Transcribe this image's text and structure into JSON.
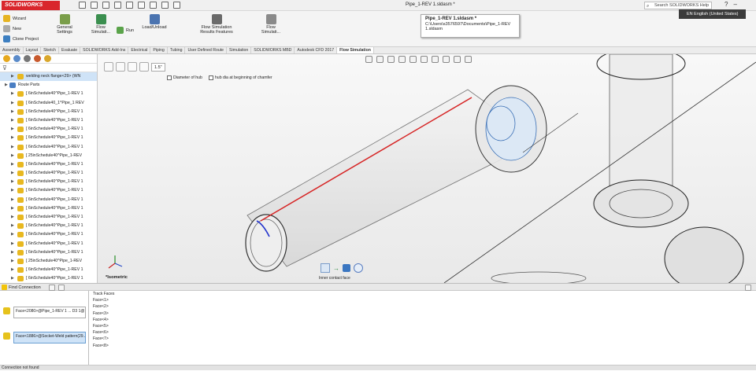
{
  "app": {
    "logo": "SOLIDWORKS",
    "doc_title": "Pipe_1-REV 1.sldasm *",
    "search_help": "Search SOLIDWORKS Help"
  },
  "ribbon": {
    "wizard": "Wizard",
    "new": "New",
    "clone_project": "Clone Project",
    "general_settings": "General Settings",
    "flow_simulation": "Flow Simulati...",
    "run": "Run",
    "load_unload": "Load/Unload",
    "flow_results": "Flow Simulation Results Features",
    "flow_sim_2": "Flow Simulati..."
  },
  "tooltip": {
    "title": "Pipe_1-REV 1.sldasm *",
    "path_line1": "C:\\Users\\s3576597\\Documents\\Pipe_1-REV",
    "path_line2": "1.sldasm"
  },
  "language": "EN English (United States)",
  "tabs": [
    "Assembly",
    "Layout",
    "Sketch",
    "Evaluate",
    "SOLIDWORKS Add-Ins",
    "Electrical",
    "Piping",
    "Tubing",
    "User Defined Route",
    "Simulation",
    "SOLIDWORKS MBD",
    "Autodesk CFD 2017",
    "Flow Simulation"
  ],
  "active_tab": "Flow Simulation",
  "tree": [
    {
      "label": "welding neck flange<29> (WN",
      "indent": 1,
      "sel": true
    },
    {
      "label": "Route Parts",
      "indent": 0,
      "sel": false
    },
    {
      "label": "[ 6inSchedule40^Pipe_1-REV 1",
      "indent": 1
    },
    {
      "label": "[ 6inSchedule40_1^Pipe_1 REV",
      "indent": 1
    },
    {
      "label": "[ 6inSchedule40^Pipe_1-REV 1",
      "indent": 1
    },
    {
      "label": "[ 6inSchedule40^Pipe_1-REV 1",
      "indent": 1
    },
    {
      "label": "[ 6inSchedule40^Pipe_1-REV 1",
      "indent": 1
    },
    {
      "label": "[ 6inSchedule40^Pipe_1-REV 1",
      "indent": 1
    },
    {
      "label": "[ 6inSchedule40^Pipe_1-REV 1",
      "indent": 1
    },
    {
      "label": "[ 25inSchedule40^Pipe_1-REV",
      "indent": 1
    },
    {
      "label": "[ 6inSchedule40^Pipe_1-REV 1",
      "indent": 1
    },
    {
      "label": "[ 6inSchedule40^Pipe_1-REV 1",
      "indent": 1
    },
    {
      "label": "[ 6inSchedule40^Pipe_1-REV 1",
      "indent": 1
    },
    {
      "label": "[ 6inSchedule40^Pipe_1-REV 1",
      "indent": 1
    },
    {
      "label": "[ 6inSchedule40^Pipe_1-REV 1",
      "indent": 1
    },
    {
      "label": "[ 6inSchedule40^Pipe_1-REV 1",
      "indent": 1
    },
    {
      "label": "[ 6inSchedule40^Pipe_1-REV 1",
      "indent": 1
    },
    {
      "label": "[ 6inSchedule40^Pipe_1-REV 1",
      "indent": 1
    },
    {
      "label": "[ 6inSchedule40^Pipe_1-REV 1",
      "indent": 1
    },
    {
      "label": "[ 6inSchedule40^Pipe_1-REV 1",
      "indent": 1
    },
    {
      "label": "[ 6inSchedule40^Pipe_1-REV 1",
      "indent": 1
    },
    {
      "label": "[ 25inSchedule40^Pipe_1-REV",
      "indent": 1
    },
    {
      "label": "[ 6inSchedule40^Pipe_1-REV 1",
      "indent": 1
    },
    {
      "label": "[ 6inSchedule40^Pipe_1-REV 1",
      "indent": 1
    }
  ],
  "viewport": {
    "pm_text": "1.5\"",
    "opt1": "Diameter of hub",
    "opt2": "hub dia at beginning of chamfer",
    "view_label": "*Isometric",
    "popup_label": "Inner contact face"
  },
  "bottom": {
    "title": "Find Connection",
    "conn1": "Face<2080>@Pipe_1-REV 1 ... D3 1@",
    "conn2": "Face<1886>@Socket-Weld pattern(29...",
    "faces_header": "Track Faces",
    "faces": [
      "Face<1>",
      "Face<2>",
      "Face<3>",
      "Face<4>",
      "Face<5>",
      "Face<6>",
      "Face<7>",
      "Face<8>"
    ]
  },
  "status": "Connection not found"
}
